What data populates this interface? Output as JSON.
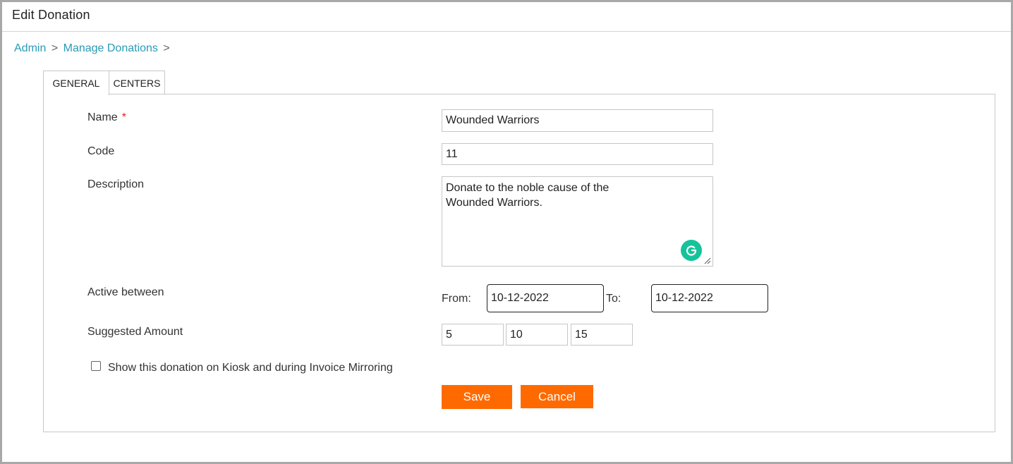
{
  "window": {
    "title": "Edit Donation"
  },
  "breadcrumb": {
    "items": [
      "Admin",
      "Manage Donations"
    ],
    "separator": ">"
  },
  "tabs": [
    {
      "label": "GENERAL",
      "active": true
    },
    {
      "label": "CENTERS",
      "active": false
    }
  ],
  "form": {
    "name": {
      "label": "Name",
      "required_mark": "*",
      "value": "Wounded Warriors"
    },
    "code": {
      "label": "Code",
      "value": "11"
    },
    "description": {
      "label": "Description",
      "value": "Donate to the noble cause of the Wounded Warriors."
    },
    "active_between": {
      "label": "Active between",
      "from_label": "From:",
      "from_value": "10-12-2022",
      "to_label": "To:",
      "to_value": "10-12-2022"
    },
    "suggested_amount": {
      "label": "Suggested Amount",
      "values": [
        "5",
        "10",
        "15"
      ]
    },
    "kiosk_checkbox": {
      "label": "Show this donation on Kiosk and during Invoice Mirroring",
      "checked": false
    }
  },
  "buttons": {
    "save": "Save",
    "cancel": "Cancel"
  },
  "colors": {
    "accent": "#ff6a00",
    "link": "#2a9bb5",
    "grammarly": "#15c39a",
    "required": "#e02020"
  }
}
